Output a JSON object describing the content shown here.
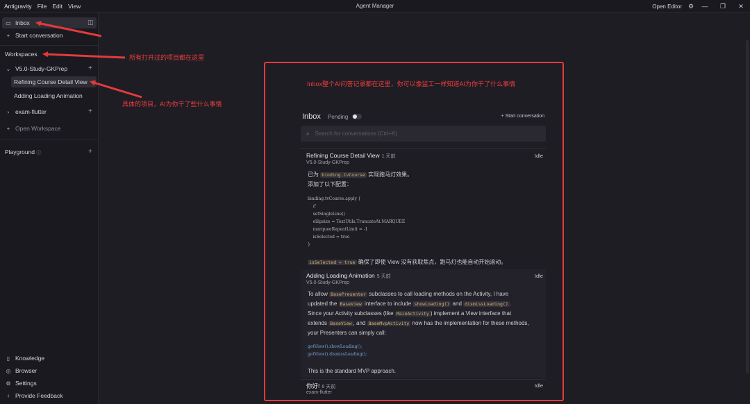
{
  "titlebar": {
    "app_name": "Antigravity",
    "menu": [
      "File",
      "Edit",
      "View"
    ],
    "title": "Agent Manager",
    "open_editor": "Open Editor"
  },
  "sidebar": {
    "inbox": "Inbox",
    "start_conversation": "Start conversation",
    "workspaces_label": "Workspaces",
    "workspace1": {
      "name": "V5.0-Study-GKPrep",
      "items": [
        "Refining Course Detail View",
        "Adding Loading Animation"
      ]
    },
    "workspace2": {
      "name": "exam-flutter"
    },
    "open_workspace": "Open Workspace",
    "playground": "Playground",
    "bottom": [
      "Knowledge",
      "Browser",
      "Settings",
      "Provide Feedback"
    ]
  },
  "annotations": {
    "a1": "所有打开过的项目都在这里",
    "a2": "具体的项目，AI为你干了些什么事情",
    "a3": "Inbox整个AI问答记录都在这里，你可以像监工一样知道AI为你干了什么事情"
  },
  "inbox": {
    "title": "Inbox",
    "pending": "Pending",
    "start_conversation": "Start conversation",
    "search_placeholder": "Search for conversations (Ctrl+K)",
    "conv1": {
      "title": "Refining Course Detail View",
      "ago": "1 天前",
      "workspace": "V5.0-Study-GKPrep",
      "status": "Idle",
      "line1_pre": "已为",
      "line1_code": "binding.tvCourse",
      "line1_post": "实现跑马灯效果。",
      "line2": "添加了以下配置：",
      "code": "binding.tvCourse.apply {\n    //\n    setSingleLine()\n    ellipsize = TextUtils.TruncateAt.MARQUEE\n    marqueeRepeatLimit = -1\n    isSelected = true\n}",
      "footer_code": "isSelected = true",
      "footer_post": "确保了即使 View 没有获取焦点，跑马灯也能自动开始滚动。"
    },
    "conv2": {
      "title": "Adding Loading Animation",
      "ago": "5 天前",
      "workspace": "V5.0-Study-GKPrep",
      "status": "Idle",
      "p1_a": "To allow",
      "p1_code1": "BasePresenter",
      "p1_b": "subclasses to call loading methods on the Activity, I have",
      "p2_a": "updated the",
      "p2_code1": "BaseView",
      "p2_b": "interface to include",
      "p2_code2": "showLoading()",
      "p2_c": "and",
      "p2_code3": "dismissLoading()",
      "p2_d": ".",
      "p3_a": "Since your Activity subclasses (like",
      "p3_code1": "MainActivity",
      "p3_b": ") implement a View interface that",
      "p4_a": "extends",
      "p4_code1": "BaseView",
      "p4_b": ", and",
      "p4_code2": "BaseMvpActivity",
      "p4_c": "now has the implementation for these methods,",
      "p5": "your Presenters can simply call:",
      "code": "getView().showLoading();\ngetView().dismissLoading();",
      "footer": "This is the standard MVP approach."
    },
    "conv3": {
      "title": "你好!",
      "ago": "6 天前",
      "workspace": "exam-flutter",
      "status": "Idle"
    }
  },
  "colors": {
    "annotation_red": "#e23b3b",
    "code_accent": "#d4b06a"
  }
}
